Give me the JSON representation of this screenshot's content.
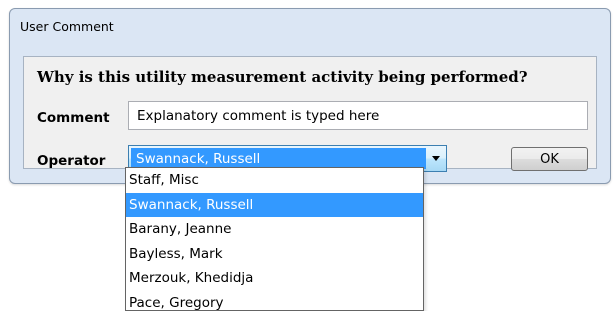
{
  "dialog": {
    "title": "User Comment",
    "question": "Why is this utility measurement activity being performed?",
    "comment_label": "Comment",
    "comment_value": "Explanatory comment is typed here",
    "operator_label": "Operator",
    "operator_selected": "Swannack, Russell",
    "ok_label": "OK"
  },
  "operator_options": [
    {
      "label": "Staff, Misc",
      "selected": false
    },
    {
      "label": "Swannack, Russell",
      "selected": true
    },
    {
      "label": "Barany, Jeanne",
      "selected": false
    },
    {
      "label": "Bayless, Mark",
      "selected": false
    },
    {
      "label": "Merzouk, Khedidja",
      "selected": false
    },
    {
      "label": "Pace, Gregory",
      "selected": false
    }
  ],
  "colors": {
    "selection": "#3399ff",
    "dialog_frame": "#dbe6f4",
    "client_area": "#f0f0f0"
  },
  "icons": {
    "dropdown": "chevron-down-icon"
  }
}
